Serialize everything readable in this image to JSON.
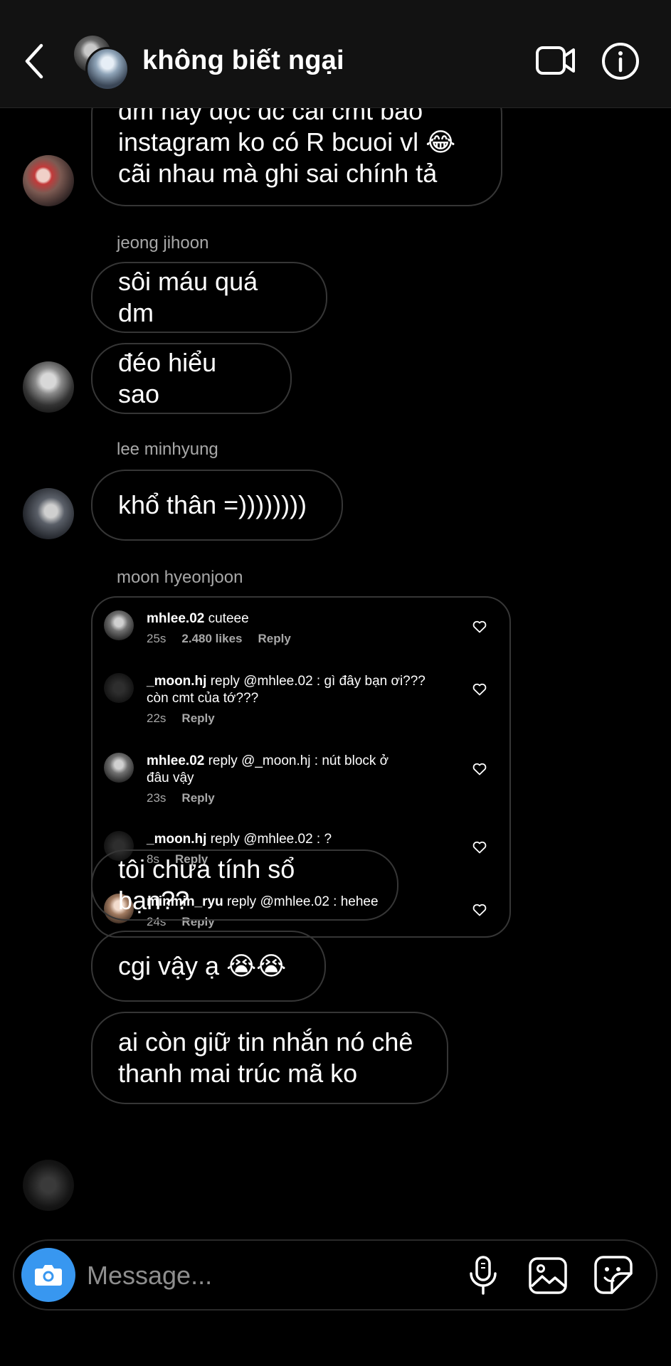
{
  "header": {
    "title": "không biết ngại",
    "back_icon": "chevron-left-icon",
    "video_icon": "video-camera-icon",
    "info_icon": "info-icon"
  },
  "messages": [
    {
      "type": "text",
      "text": "dm nay đọc dc cái cmt bảo\ninstagram ko có R bcuoi vl 😂\ncãi nhau mà ghi sai chính tả"
    },
    {
      "type": "sender",
      "name": "jeong jihoon"
    },
    {
      "type": "text",
      "text": "sôi máu quá dm"
    },
    {
      "type": "text",
      "text": "đéo hiểu sao"
    },
    {
      "type": "sender",
      "name": "lee minhyung"
    },
    {
      "type": "text",
      "text": "khổ thân =))))))))"
    },
    {
      "type": "sender",
      "name": "moon hyeonjoon"
    },
    {
      "type": "text",
      "text": "tôi chưa tính sổ bạn??"
    },
    {
      "type": "text",
      "text": "cgi vậy ạ 😭😭"
    },
    {
      "type": "text",
      "text": "ai còn giữ tin nhắn nó chê\nthanh mai trúc mã ko"
    }
  ],
  "comments": [
    {
      "user": "mhlee.02",
      "body": " cuteee",
      "time": "25s",
      "likes": "2.480 likes",
      "reply": "Reply"
    },
    {
      "user": "_moon.hj",
      "body": " reply @mhlee.02 : gì đây bạn ơi???\ncòn cmt của tớ???",
      "time": "22s",
      "reply": "Reply"
    },
    {
      "user": "mhlee.02",
      "body": " reply @_moon.hj : nút block ở\nđâu vậy",
      "time": "23s",
      "reply": "Reply"
    },
    {
      "user": "_moon.hj",
      "body": " reply @mhlee.02 : ?",
      "time": "8s",
      "reply": "Reply"
    },
    {
      "user": "minmin_ryu",
      "body": " reply @mhlee.02 : hehee",
      "time": "24s",
      "reply": "Reply"
    }
  ],
  "composer": {
    "placeholder": "Message...",
    "camera_icon": "camera-icon",
    "mic_icon": "microphone-icon",
    "gallery_icon": "image-icon",
    "sticker_icon": "sticker-icon"
  },
  "colors": {
    "background": "#000000",
    "header_bg": "#121212",
    "bubble_border": "#363636",
    "secondary_text": "#a8a8a8",
    "camera_button": "#3897f0"
  }
}
